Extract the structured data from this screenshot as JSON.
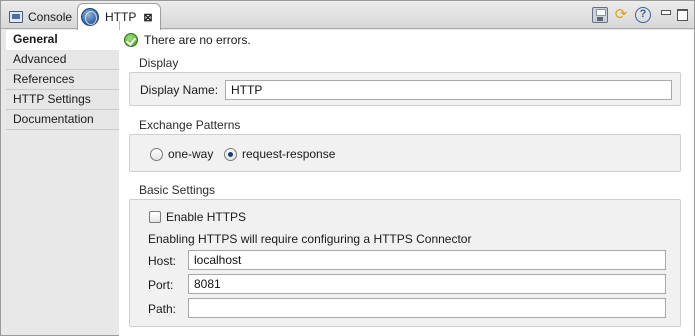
{
  "tabs": {
    "console_label": "Console",
    "http_label": "HTTP",
    "close_glyph": "⊠"
  },
  "toolbar": {
    "help_glyph": "?",
    "refresh_glyph": "⟳"
  },
  "status": {
    "message": "There are no errors.",
    "icon": "check-circle-icon"
  },
  "nav": {
    "items": [
      {
        "label": "General",
        "active": true
      },
      {
        "label": "Advanced",
        "active": false
      },
      {
        "label": "References",
        "active": false
      },
      {
        "label": "HTTP Settings",
        "active": false
      },
      {
        "label": "Documentation",
        "active": false
      }
    ]
  },
  "display": {
    "title": "Display",
    "name_label": "Display Name:",
    "name_value": "HTTP"
  },
  "exchange": {
    "title": "Exchange Patterns",
    "options": [
      {
        "label": "one-way",
        "selected": false
      },
      {
        "label": "request-response",
        "selected": true
      }
    ]
  },
  "basic": {
    "title": "Basic Settings",
    "https_label": "Enable HTTPS",
    "https_checked": false,
    "https_note": "Enabling HTTPS will require configuring a HTTPS Connector",
    "host_label": "Host:",
    "host_value": "localhost",
    "port_label": "Port:",
    "port_value": "8081",
    "path_label": "Path:",
    "path_value": ""
  },
  "colors": {
    "status_ok": "#3f9a1c",
    "active_nav_bg": "#ffffff",
    "panel_bg": "#f1f1f1"
  }
}
